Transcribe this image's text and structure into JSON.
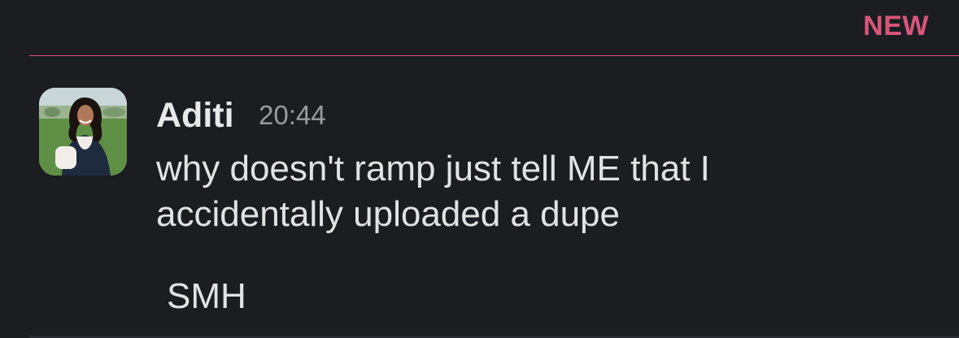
{
  "divider": {
    "label": "NEW",
    "color": "#d8567a"
  },
  "message": {
    "sender": "Aditi",
    "timestamp": "20:44",
    "body": "why doesn't ramp just tell ME that I accidentally uploaded a dupe",
    "followup": "SMH",
    "avatar_icon": "user-photo-avatar"
  },
  "colors": {
    "background": "#1b1d21",
    "text": "#e2e2e3",
    "muted": "#9a9b9e"
  }
}
